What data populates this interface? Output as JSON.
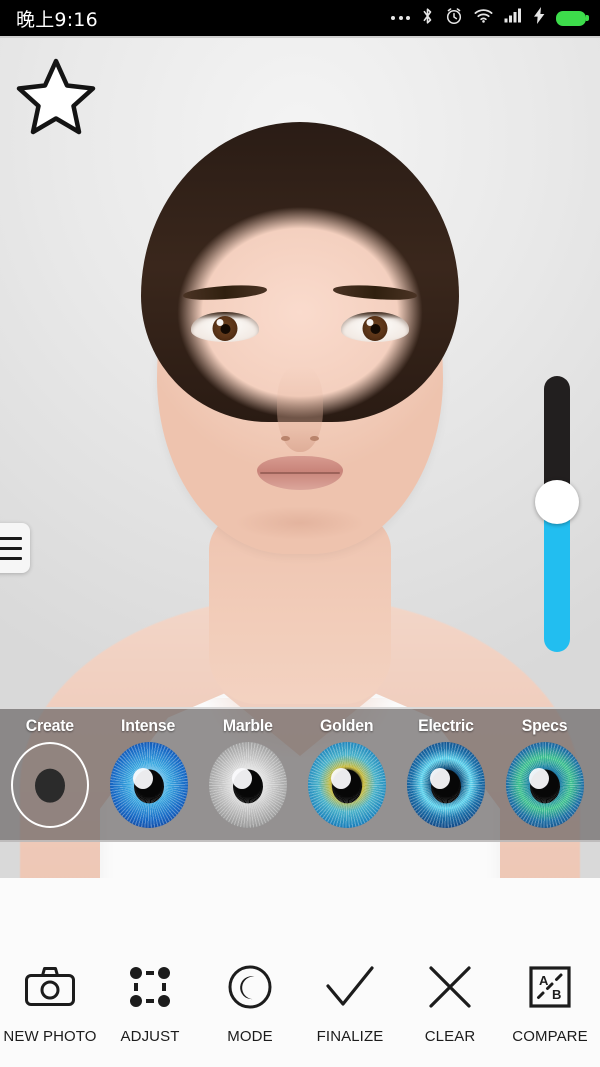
{
  "statusbar": {
    "time": "晚上9:16",
    "icons": [
      "more-dots-icon",
      "bluetooth-icon",
      "alarm-icon",
      "wifi-icon",
      "signal-icon",
      "charging-bolt-icon",
      "battery-icon"
    ]
  },
  "stage": {
    "star_button": "star-icon",
    "menu_button": "hamburger-menu-icon",
    "slider": {
      "name": "intensity-slider",
      "track_top_color": "#221f1f",
      "track_bottom_color": "#22bef0",
      "thumb_color": "#ffffff"
    }
  },
  "carousel": {
    "selected_index": 0,
    "presets": [
      {
        "label": "Create",
        "style": "selected"
      },
      {
        "label": "Intense",
        "style": "iris-intense"
      },
      {
        "label": "Marble",
        "style": "iris-marble"
      },
      {
        "label": "Golden",
        "style": "iris-golden"
      },
      {
        "label": "Electric",
        "style": "iris-electric"
      },
      {
        "label": "Specs",
        "style": "iris-specs"
      }
    ]
  },
  "toolbar": {
    "items": [
      {
        "label": "NEW PHOTO",
        "icon": "camera-icon"
      },
      {
        "label": "ADJUST",
        "icon": "crop-handles-icon"
      },
      {
        "label": "MODE",
        "icon": "eye-mode-icon"
      },
      {
        "label": "FINALIZE",
        "icon": "check-icon"
      },
      {
        "label": "CLEAR",
        "icon": "close-x-icon"
      },
      {
        "label": "COMPARE",
        "icon": "compare-ab-icon"
      }
    ]
  },
  "colors": {
    "accent_cyan": "#22bef0",
    "status_bar": "#000000",
    "battery_green": "#3ddc4b",
    "carousel_overlay": "rgba(108,104,104,0.72)",
    "toolbar_bg": "#fbfbfb"
  }
}
